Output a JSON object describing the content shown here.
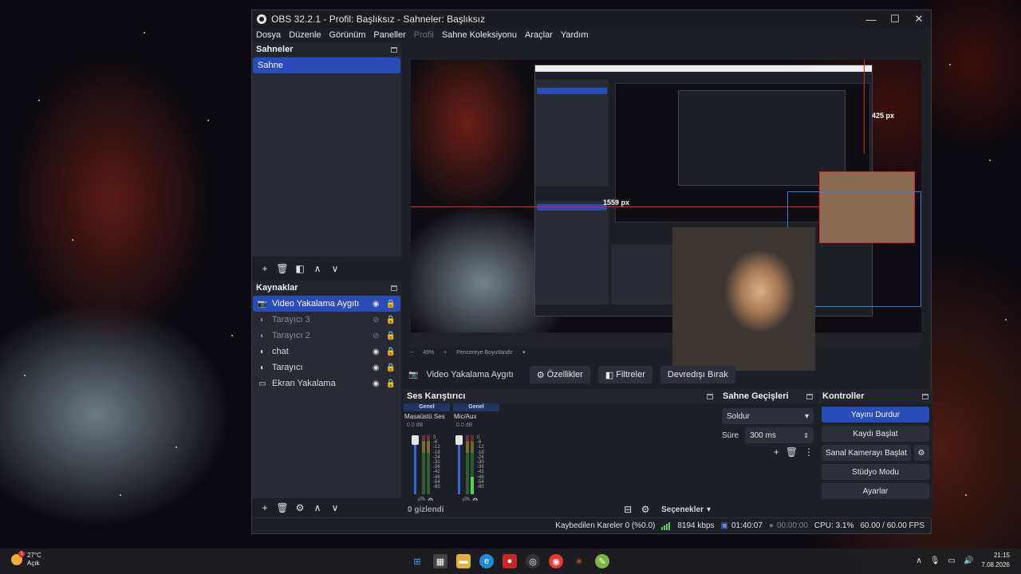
{
  "window": {
    "title": "OBS 32.2.1 - Profil: Başlıksız - Sahneler: Başlıksız",
    "min": "—",
    "max": "☐",
    "close": "✕"
  },
  "menu": [
    "Dosya",
    "Düzenle",
    "Görünüm",
    "Paneller",
    "Profil",
    "Sahne Koleksiyonu",
    "Araçlar",
    "Yardım"
  ],
  "scenes": {
    "title": "Sahneler",
    "items": [
      "Sahne"
    ]
  },
  "sources": {
    "title": "Kaynaklar",
    "items": [
      {
        "name": "Video Yakalama Aygıtı",
        "icon": "camera-icon",
        "visible": true
      },
      {
        "name": "Tarayıcı 3",
        "icon": "globe-icon",
        "visible": false
      },
      {
        "name": "Tarayıcı 2",
        "icon": "globe-icon",
        "visible": false
      },
      {
        "name": "chat",
        "icon": "globe-icon",
        "visible": true
      },
      {
        "name": "Tarayıcı",
        "icon": "globe-icon",
        "visible": true
      },
      {
        "name": "Ekran Yakalama",
        "icon": "monitor-icon",
        "visible": true
      }
    ]
  },
  "preview": {
    "measure_h": "1559 px",
    "measure_v": "425 px",
    "zoom": "49%",
    "zoom_minus": "−",
    "zoom_plus": "+",
    "fit_label": "Pencereye Boyutlandır"
  },
  "source_bar": {
    "name": "Video Yakalama Aygıtı",
    "properties": "Özellikler",
    "filters": "Filtreler",
    "deactivate": "Devredışı Bırak"
  },
  "mixer": {
    "title": "Ses Karıştırıcı",
    "channels": [
      {
        "header": "Genel",
        "name": "Masaüstü Ses",
        "db": "0.0 dB"
      },
      {
        "header": "Genel",
        "name": "Mic/Aux",
        "db": "0.0 dB"
      }
    ],
    "ticks": [
      "0",
      "-6",
      "-12",
      "-18",
      "-24",
      "-30",
      "-36",
      "-42",
      "-48",
      "-54",
      "-60"
    ],
    "hidden": "0 gizlendi",
    "options": "Seçenekler"
  },
  "transitions": {
    "title": "Sahne Geçişleri",
    "selected": "Soldur",
    "duration_label": "Süre",
    "duration_value": "300 ms"
  },
  "controls": {
    "title": "Kontroller",
    "buttons": [
      "Yayını Durdur",
      "Kaydı Başlat",
      "Sanal Kamerayı Başlat",
      "Stüdyo Modu",
      "Ayarlar"
    ]
  },
  "status": {
    "dropped": "Kaybedilen Kareler 0 (%0.0)",
    "bitrate": "8194 kbps",
    "stream_time": "01:40:07",
    "rec_time": "00:00:00",
    "cpu": "CPU: 3.1%",
    "fps": "60.00 / 60.00 FPS"
  },
  "taskbar": {
    "temp": "27°C",
    "weather": "Açık",
    "badge": "1",
    "time": "21:15",
    "date": "7.08.2026"
  }
}
